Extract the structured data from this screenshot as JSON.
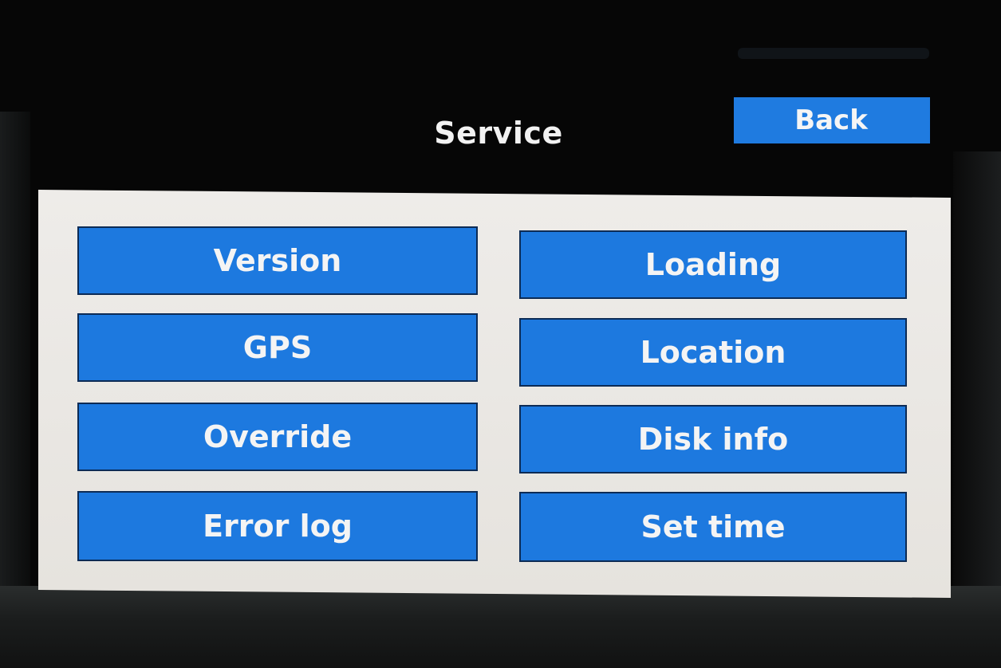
{
  "header": {
    "title": "Service",
    "back_label": "Back"
  },
  "menu": {
    "left": [
      {
        "label": "Version"
      },
      {
        "label": "GPS"
      },
      {
        "label": "Override"
      },
      {
        "label": "Error log"
      }
    ],
    "right": [
      {
        "label": "Loading"
      },
      {
        "label": "Location"
      },
      {
        "label": "Disk info"
      },
      {
        "label": "Set time"
      }
    ]
  },
  "colors": {
    "button_blue": "#1d79df",
    "panel_bg": "#eeece9",
    "screen_bg": "#050505",
    "text": "#f4f4f4"
  }
}
